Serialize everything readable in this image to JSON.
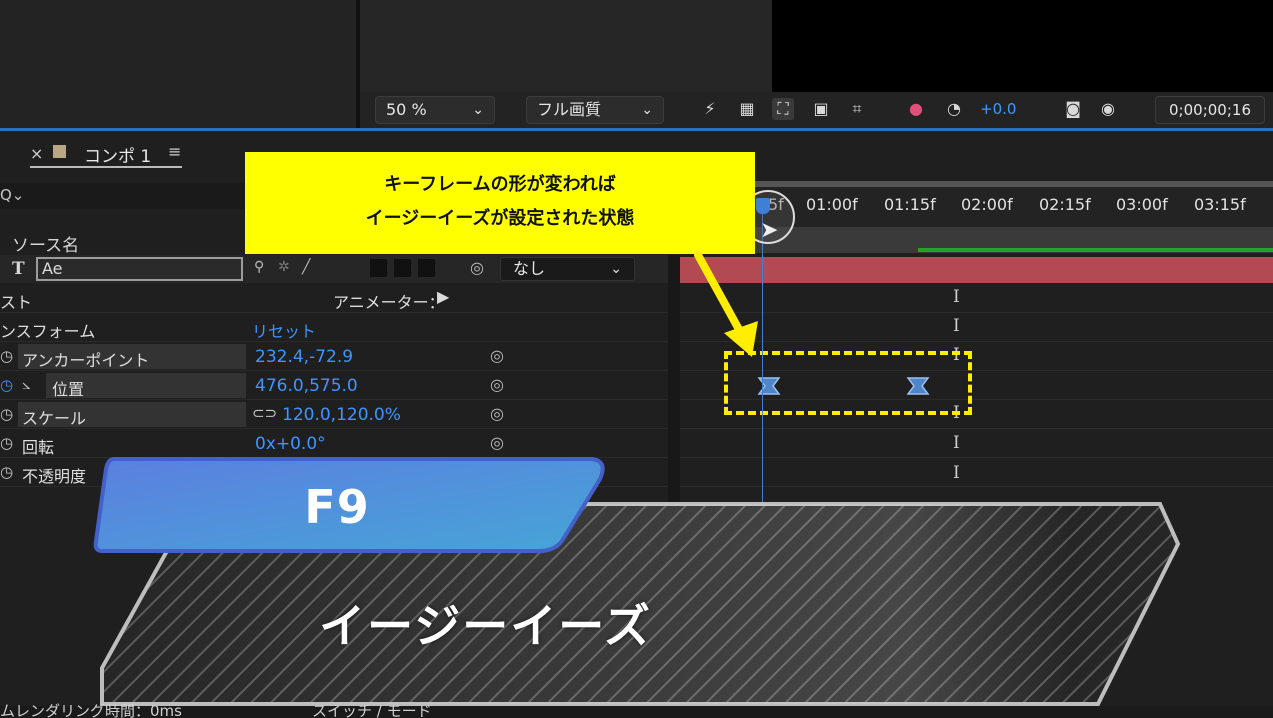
{
  "viewer": {
    "zoom": "50 %",
    "resolution": "フル画質",
    "exposure": "+0.0",
    "timecode": "0;00;00;16"
  },
  "timeline": {
    "tab_close": "×",
    "tab_label": "コンポ 1",
    "tab_menu": "≡",
    "search_icon": "Q⌄",
    "source_name": "ソース名",
    "ruler_ticks": [
      "5f",
      "01:00f",
      "01:15f",
      "02:00f",
      "02:15f",
      "03:00f",
      "03:15f"
    ]
  },
  "layer": {
    "type_icon": "T",
    "name": "Ae",
    "parent": "なし"
  },
  "properties": {
    "text_group": "スト",
    "animator_label": "アニメーター：",
    "transform_group": "ンスフォーム",
    "reset": "リセット",
    "anchor": {
      "label": "アンカーポイント",
      "value": "232.4,-72.9"
    },
    "position": {
      "label": "位置",
      "value": "476.0,575.0"
    },
    "scale": {
      "label": "スケール",
      "value": "120.0,120.0%"
    },
    "rotation": {
      "label": "回転",
      "value": "0x+0.0°"
    },
    "opacity": {
      "label": "不透明度"
    }
  },
  "callout": {
    "line1": "キーフレームの形が変われば",
    "line2": "イージーイーズが設定された状態"
  },
  "banners": {
    "hotkey": "F9",
    "title": "イージーイーズ"
  },
  "footer": {
    "render_time": "ムレンダリング時間：0ms",
    "switch_mode": "スイッチ / モード"
  },
  "colors": {
    "accent_blue": "#3d96ff",
    "layer_bar": "#b24a52",
    "callout_yellow": "#ffff00",
    "banner_blue": "#4a7fdc"
  }
}
